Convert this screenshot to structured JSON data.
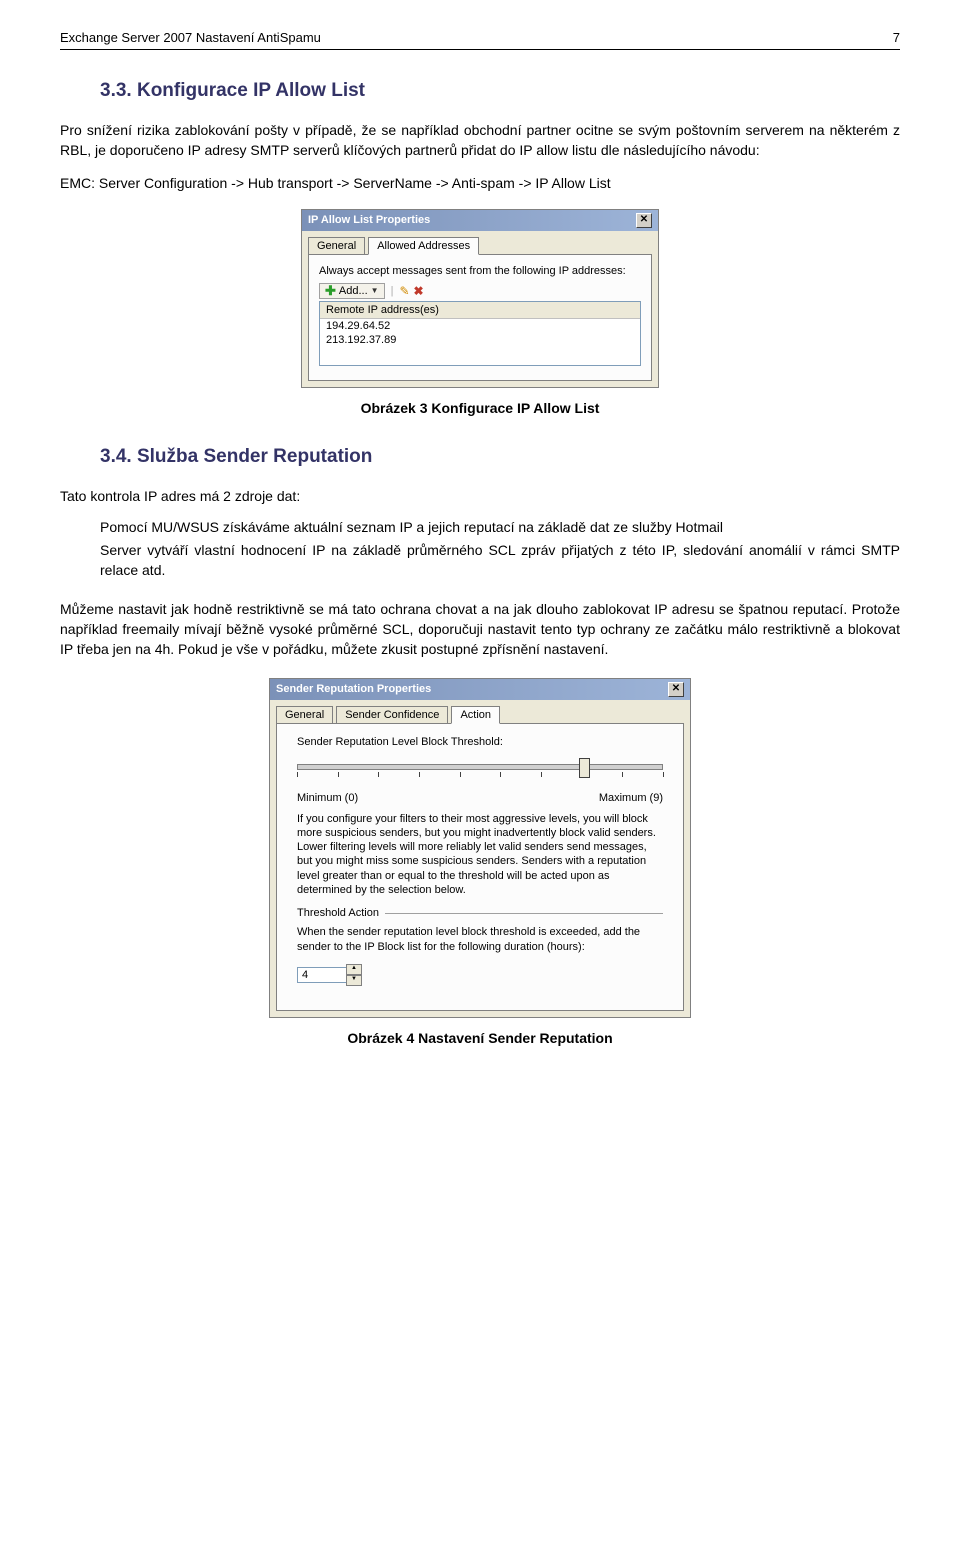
{
  "header": {
    "title": "Exchange Server 2007 Nastavení AntiSpamu",
    "page_number": "7"
  },
  "section1": {
    "number_title": "3.3.  Konfigurace IP Allow List",
    "para": "Pro snížení rizika zablokování pošty v případě, že se například obchodní partner ocitne se svým poštovním serverem na některém z RBL, je doporučeno IP adresy SMTP serverů klíčových partnerů přidat do IP allow listu dle následujícího návodu:",
    "emc": "EMC: Server Configuration -> Hub transport -> ServerName -> Anti-spam ->   IP Allow List"
  },
  "dialog1": {
    "title": "IP Allow List Properties",
    "tabs": {
      "general": "General",
      "allowed": "Allowed Addresses"
    },
    "label": "Always accept messages sent from the following IP addresses:",
    "add_btn": "Add...",
    "list_header": "Remote IP address(es)",
    "rows": [
      "194.29.64.52",
      "213.192.37.89"
    ]
  },
  "caption1": "Obrázek 3 Konfigurace IP Allow List",
  "section2": {
    "number_title": "3.4.  Služba Sender Reputation",
    "intro": "Tato kontrola IP adres má 2 zdroje dat:",
    "bullet1": "Pomocí MU/WSUS získáváme aktuální seznam IP a jejich reputací na základě dat ze služby Hotmail",
    "bullet2": "Server vytváří vlastní hodnocení IP na základě průměrného SCL zpráv přijatých z této IP, sledování anomálií v rámci SMTP relace atd.",
    "para2": "Můžeme nastavit jak hodně restriktivně se má tato ochrana chovat a na jak dlouho zablokovat IP adresu se špatnou reputací. Protože například freemaily mívají běžně vysoké průměrné SCL, doporučuji nastavit tento typ ochrany ze začátku málo restriktivně a blokovat IP třeba jen na 4h. Pokud je vše v pořádku, můžete zkusit postupné zpřísnění nastavení."
  },
  "dialog2": {
    "title": "Sender Reputation Properties",
    "tabs": {
      "general": "General",
      "conf": "Sender Confidence",
      "action": "Action"
    },
    "block_label": "Sender Reputation Level Block Threshold:",
    "min_label": "Minimum (0)",
    "max_label": "Maximum (9)",
    "help": "If you configure your filters to their most aggressive levels, you will block more suspicious senders, but you might inadvertently block valid senders. Lower filtering levels will more reliably let valid senders send messages, but you might miss some suspicious senders. Senders with a reputation level greater than or equal to the threshold will be acted upon as determined by the selection below.",
    "threshold_section": "Threshold Action",
    "threshold_text": "When the sender reputation level block threshold is exceeded, add the sender to the IP Block list for the following duration (hours):",
    "spin_value": "4"
  },
  "caption2": "Obrázek 4 Nastavení Sender Reputation"
}
